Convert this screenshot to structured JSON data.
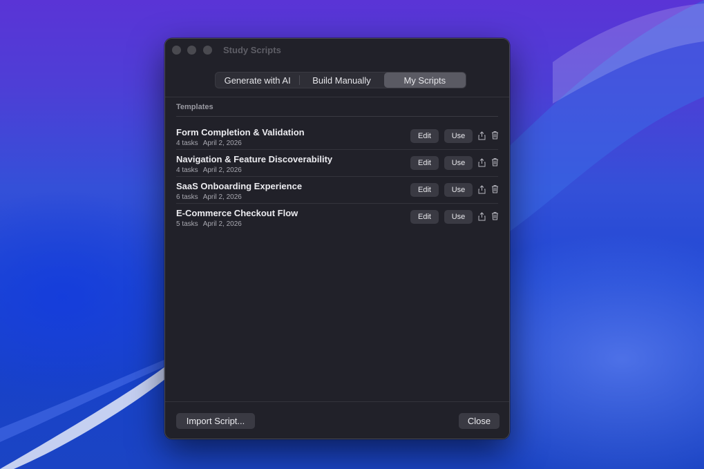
{
  "window": {
    "title": "Study Scripts"
  },
  "tabs": [
    {
      "label": "Generate with AI",
      "selected": false
    },
    {
      "label": "Build Manually",
      "selected": false
    },
    {
      "label": "My Scripts",
      "selected": true
    }
  ],
  "section": {
    "label": "Templates"
  },
  "templates": [
    {
      "title": "Form Completion & Validation",
      "tasks": "4 tasks",
      "date": "April 2, 2026"
    },
    {
      "title": "Navigation & Feature Discoverability",
      "tasks": "4 tasks",
      "date": "April 2, 2026"
    },
    {
      "title": "SaaS Onboarding Experience",
      "tasks": "6 tasks",
      "date": "April 2, 2026"
    },
    {
      "title": "E-Commerce Checkout Flow",
      "tasks": "5 tasks",
      "date": "April 2, 2026"
    }
  ],
  "row_actions": {
    "edit": "Edit",
    "use": "Use",
    "share_icon": "share-icon",
    "trash_icon": "trash-icon"
  },
  "footer": {
    "import_label": "Import Script...",
    "close_label": "Close"
  },
  "colors": {
    "window_bg": "#212129",
    "selected_segment": "#5a5a63",
    "button_bg": "#3a3a43"
  }
}
